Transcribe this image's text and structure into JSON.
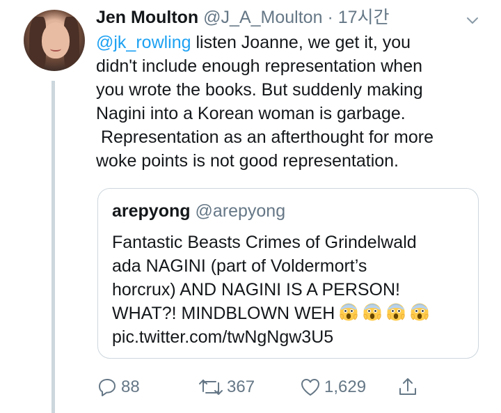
{
  "tweet": {
    "author_name": "Jen Moulton",
    "author_handle": "@J_A_Moulton",
    "separator": "·",
    "time": "17시간",
    "text_lines": [
      {
        "mention": "@jk_rowling",
        "rest": " listen Joanne, we get it, you"
      },
      "didn't include enough representation when",
      "you wrote the books. But suddenly making",
      "Nagini into a Korean woman is garbage.",
      " Representation as an afterthought for more",
      "woke points is not good representation."
    ]
  },
  "quoted_tweet": {
    "author_name": "arepyong",
    "author_handle": "@arepyong",
    "text_lines": [
      "Fantastic Beasts Crimes of Grindelwald",
      "ada NAGINI (part of Voldermort’s",
      "horcrux) AND NAGINI IS A PERSON!",
      "WHAT?! MINDBLOWN WEH",
      "pic.twitter.com/twNgNgw3U5"
    ],
    "emoji_count": 4
  },
  "actions": {
    "replies": "88",
    "retweets": "367",
    "likes": "1,629"
  },
  "icons": {
    "chevron": "chevron-down-icon",
    "reply": "reply-icon",
    "retweet": "retweet-icon",
    "like": "heart-icon",
    "share": "share-icon",
    "emoji": "screaming-face-emoji"
  },
  "colors": {
    "link": "#1da1f2",
    "muted": "#657786",
    "border": "#ccd6dd",
    "text": "#14171a"
  }
}
